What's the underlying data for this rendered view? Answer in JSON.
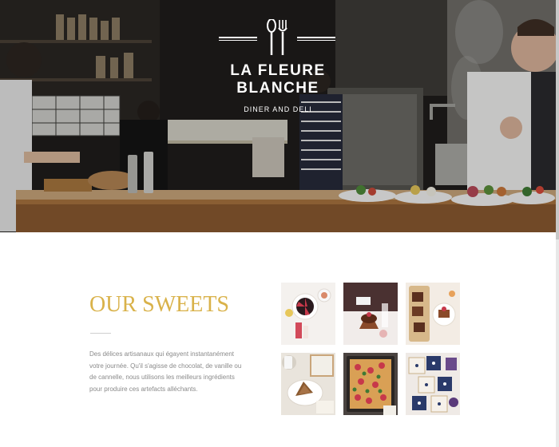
{
  "brand": {
    "name_line1": "LA FLEURE",
    "name_line2": "BLANCHE",
    "tagline": "DINER AND DELI",
    "logo_icon": "fork-spoon-icon"
  },
  "sweets": {
    "title": "OUR SWEETS",
    "description": "Des délices artisanaux qui égayent instantanément votre journée. Qu'il s'agisse de chocolat, de vanille ou de cannelle, nous utilisons les meilleurs ingrédients pour produire ces artefacts alléchants.",
    "title_color": "#d9b24a"
  },
  "gallery": [
    {
      "name": "cake-slices-plate"
    },
    {
      "name": "chocolate-cupcake"
    },
    {
      "name": "brownies-board"
    },
    {
      "name": "cake-slice-coffee"
    },
    {
      "name": "pizza-tray"
    },
    {
      "name": "decorated-cookies"
    }
  ]
}
